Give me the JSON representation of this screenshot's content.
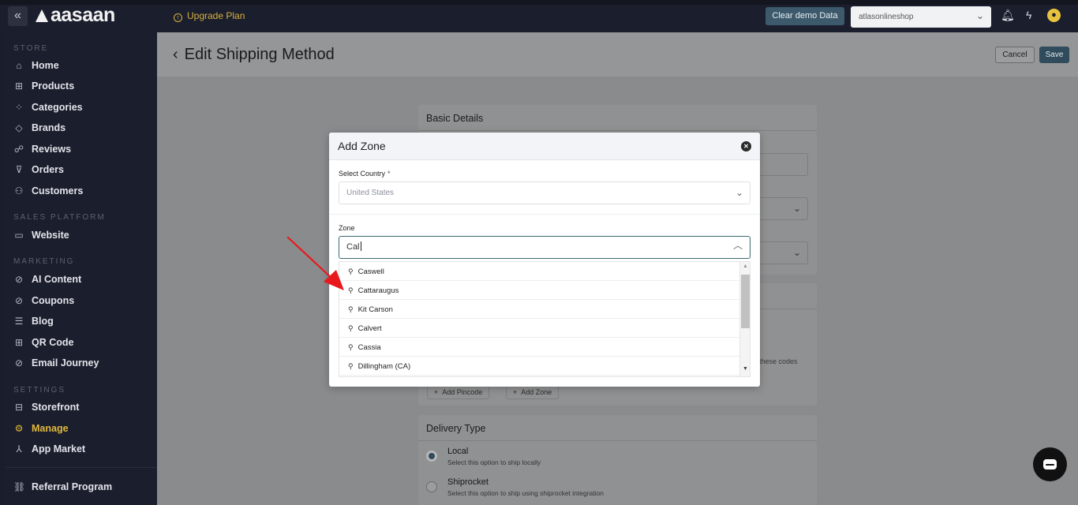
{
  "topbar": {
    "collapse_icon": "chevrons-left-icon",
    "logo": "aasaan",
    "upgrade": "Upgrade Plan",
    "clear_demo": "Clear demo Data",
    "store": "atlasonlineshop"
  },
  "sidebar": {
    "sections": [
      {
        "title": "STORE",
        "items": [
          "Home",
          "Products",
          "Categories",
          "Brands",
          "Reviews",
          "Orders",
          "Customers"
        ]
      },
      {
        "title": "SALES PLATFORM",
        "items": [
          "Website"
        ]
      },
      {
        "title": "MARKETING",
        "items": [
          "AI Content",
          "Coupons",
          "Blog",
          "QR Code",
          "Email Journey"
        ]
      },
      {
        "title": "SETTINGS",
        "items": [
          "Storefront",
          "Manage",
          "App Market"
        ]
      }
    ],
    "referral": "Referral Program",
    "active_item": "Manage",
    "active_color": "#e2b93b"
  },
  "header": {
    "title": "Edit Shipping Method",
    "cancel": "Cancel",
    "save": "Save"
  },
  "basic_details": {
    "title": "Basic Details"
  },
  "zones_card": {
    "hint": "these codes",
    "add_pincode": "Add Pincode",
    "add_zone": "Add Zone"
  },
  "delivery_type": {
    "title": "Delivery Type",
    "options": [
      {
        "label": "Local",
        "desc": "Select this option to ship locally",
        "selected": true
      },
      {
        "label": "Shiprocket",
        "desc": "Select this option to ship using shiprocket integration",
        "selected": false
      }
    ]
  },
  "modal": {
    "title": "Add Zone",
    "country_label": "Select Country",
    "required_mark": "*",
    "country_value": "United States",
    "zone_label": "Zone",
    "zone_value": "Cal",
    "suggestions": [
      "Caswell",
      "Cattaraugus",
      "Kit Carson",
      "Calvert",
      "Cassia",
      "Dillingham (CA)"
    ]
  },
  "colors": {
    "accent": "#2f4b5c",
    "annotation_arrow": "#e8191c"
  }
}
